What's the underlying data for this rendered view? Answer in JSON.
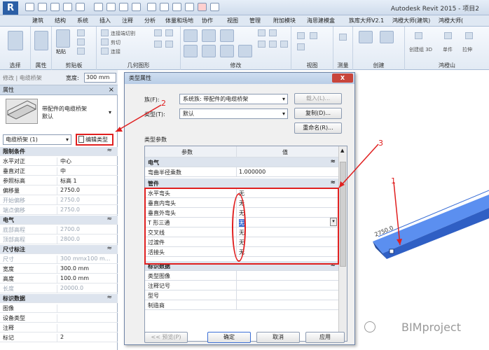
{
  "app": {
    "title": "Autodesk Revit 2015 - 项目2",
    "logo": "R"
  },
  "ribbon_tabs": [
    "建筑",
    "结构",
    "系统",
    "插入",
    "注释",
    "分析",
    "体量和场地",
    "协作",
    "视图",
    "管理",
    "附加模块",
    "海思建模盒",
    "族库大师V2.1",
    "鸿橙大师(建筑)",
    "鸿橙大师("
  ],
  "ribbon_groups": [
    "选择",
    "属性",
    "剪贴板",
    "几何图形",
    "修改",
    "视图",
    "测量",
    "创建",
    "鸿橙山"
  ],
  "ribbon_labels": {
    "paste": "粘贴",
    "modify": "修改",
    "small": [
      "连接端切割",
      "剪切",
      "连接"
    ],
    "view3d": "创建组 3D",
    "single": "单件",
    "mirror": "拉伸"
  },
  "options_bar": {
    "label": "修改 | 电缆桥架",
    "width_label": "宽度:",
    "width_value": "300 mm"
  },
  "properties": {
    "title": "属性",
    "close": "×",
    "type_name": "带配件的电缆桥架\n默认",
    "selector": "电缆桥架 (1)",
    "edit_type": "编辑类型",
    "rows": [
      {
        "group": true,
        "label": "限制条件"
      },
      {
        "label": "水平对正",
        "value": "中心"
      },
      {
        "label": "垂直对正",
        "value": "中"
      },
      {
        "label": "参照标高",
        "value": "标高 1"
      },
      {
        "label": "偏移量",
        "value": "2750.0"
      },
      {
        "label": "开始偏移",
        "value": "2750.0",
        "disabled": true
      },
      {
        "label": "端点偏移",
        "value": "2750.0",
        "disabled": true
      },
      {
        "group": true,
        "label": "电气"
      },
      {
        "label": "底部高程",
        "value": "2700.0",
        "disabled": true
      },
      {
        "label": "顶部高程",
        "value": "2800.0",
        "disabled": true
      },
      {
        "group": true,
        "label": "尺寸标注"
      },
      {
        "label": "尺寸",
        "value": "300 mmx100 m...",
        "disabled": true
      },
      {
        "label": "宽度",
        "value": "300.0 mm"
      },
      {
        "label": "高度",
        "value": "100.0 mm"
      },
      {
        "label": "长度",
        "value": "20000.0",
        "disabled": true
      },
      {
        "group": true,
        "label": "标识数据"
      },
      {
        "label": "图像",
        "value": ""
      },
      {
        "label": "设备类型",
        "value": ""
      },
      {
        "label": "注释",
        "value": ""
      },
      {
        "label": "标记",
        "value": "2"
      }
    ]
  },
  "dialog": {
    "title": "类型属性",
    "close": "X",
    "family_label": "族(F):",
    "family_value": "系统族: 带配件的电缆桥架",
    "type_label": "类型(T):",
    "type_value": "默认",
    "load_btn": "载入(L)...",
    "copy_btn": "复制(D)...",
    "rename_btn": "重命名(R)...",
    "params_label": "类型参数",
    "col_param": "参数",
    "col_value": "值",
    "rows": [
      {
        "group": true,
        "label": "电气"
      },
      {
        "label": "弯曲半径乘数",
        "value": "1.000000"
      },
      {
        "group": true,
        "label": "管件"
      },
      {
        "label": "水平弯头",
        "value": "无"
      },
      {
        "label": "垂直内弯头",
        "value": "无"
      },
      {
        "label": "垂直外弯头",
        "value": "无"
      },
      {
        "label": "T 形三通",
        "value": "无"
      },
      {
        "label": "交叉线",
        "value": "无"
      },
      {
        "label": "过渡件",
        "value": "无"
      },
      {
        "label": "活接头",
        "value": "无"
      },
      {
        "group": true,
        "label": "标识数据"
      },
      {
        "label": "类型图像",
        "value": ""
      },
      {
        "label": "注释记号",
        "value": ""
      },
      {
        "label": "型号",
        "value": ""
      },
      {
        "label": "制造商",
        "value": ""
      }
    ],
    "preview_btn": "<< 预览(P)",
    "ok_btn": "确定",
    "cancel_btn": "取消",
    "apply_btn": "应用"
  },
  "annotations": {
    "a1": "1",
    "a2": "2",
    "a3": "3"
  },
  "model_label": "2750.0",
  "watermark": "BIMproject",
  "colors": {
    "highlight": "#e02020",
    "tray": "#3b6fd6"
  }
}
